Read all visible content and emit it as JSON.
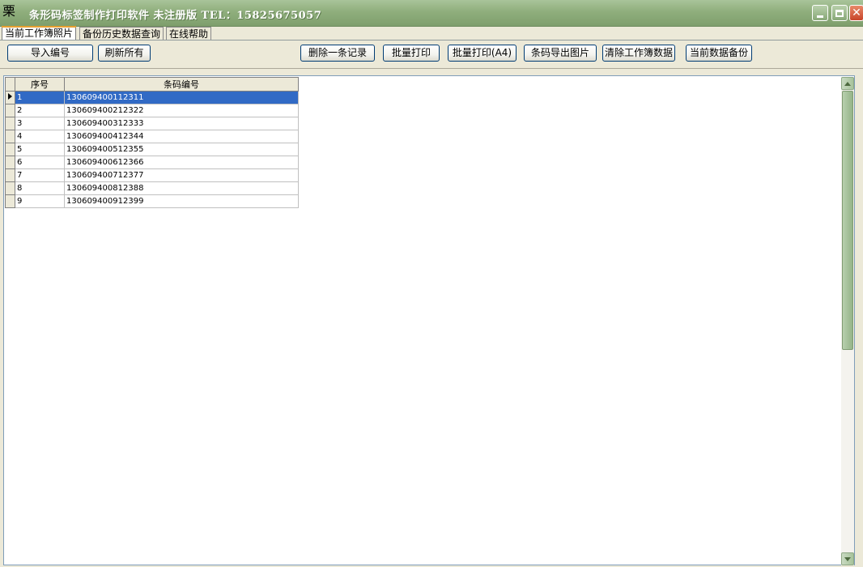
{
  "window": {
    "title": "条形码标签制作打印软件 未注册版 TEL：15825675057",
    "app_icon": "栗",
    "close_glyph": "✕"
  },
  "tabs": [
    {
      "label": "当前工作簿照片",
      "active": true
    },
    {
      "label": "备份历史数据查询",
      "active": false
    },
    {
      "label": "在线帮助",
      "active": false
    }
  ],
  "toolbar": {
    "import": "导入编号",
    "refresh": "刷新所有",
    "delete_record": "删除一条记录",
    "batch_print": "批量打印",
    "batch_print_a4": "批量打印(A4)",
    "export_image": "条码导出图片",
    "clear_workbook": "清除工作簿数据",
    "backup": "当前数据备份"
  },
  "grid": {
    "columns": [
      "序号",
      "条码编号"
    ],
    "selected_row": 0,
    "rows": [
      {
        "seq": "1",
        "code": "130609400112311"
      },
      {
        "seq": "2",
        "code": "130609400212322"
      },
      {
        "seq": "3",
        "code": "130609400312333"
      },
      {
        "seq": "4",
        "code": "130609400412344"
      },
      {
        "seq": "5",
        "code": "130609400512355"
      },
      {
        "seq": "6",
        "code": "130609400612366"
      },
      {
        "seq": "7",
        "code": "130609400712377"
      },
      {
        "seq": "8",
        "code": "130609400812388"
      },
      {
        "seq": "9",
        "code": "130609400912399"
      }
    ]
  },
  "colors": {
    "titlebar": "#8fae7c",
    "selection": "#316ac5",
    "scroll_thumb": "#a7c39b"
  }
}
